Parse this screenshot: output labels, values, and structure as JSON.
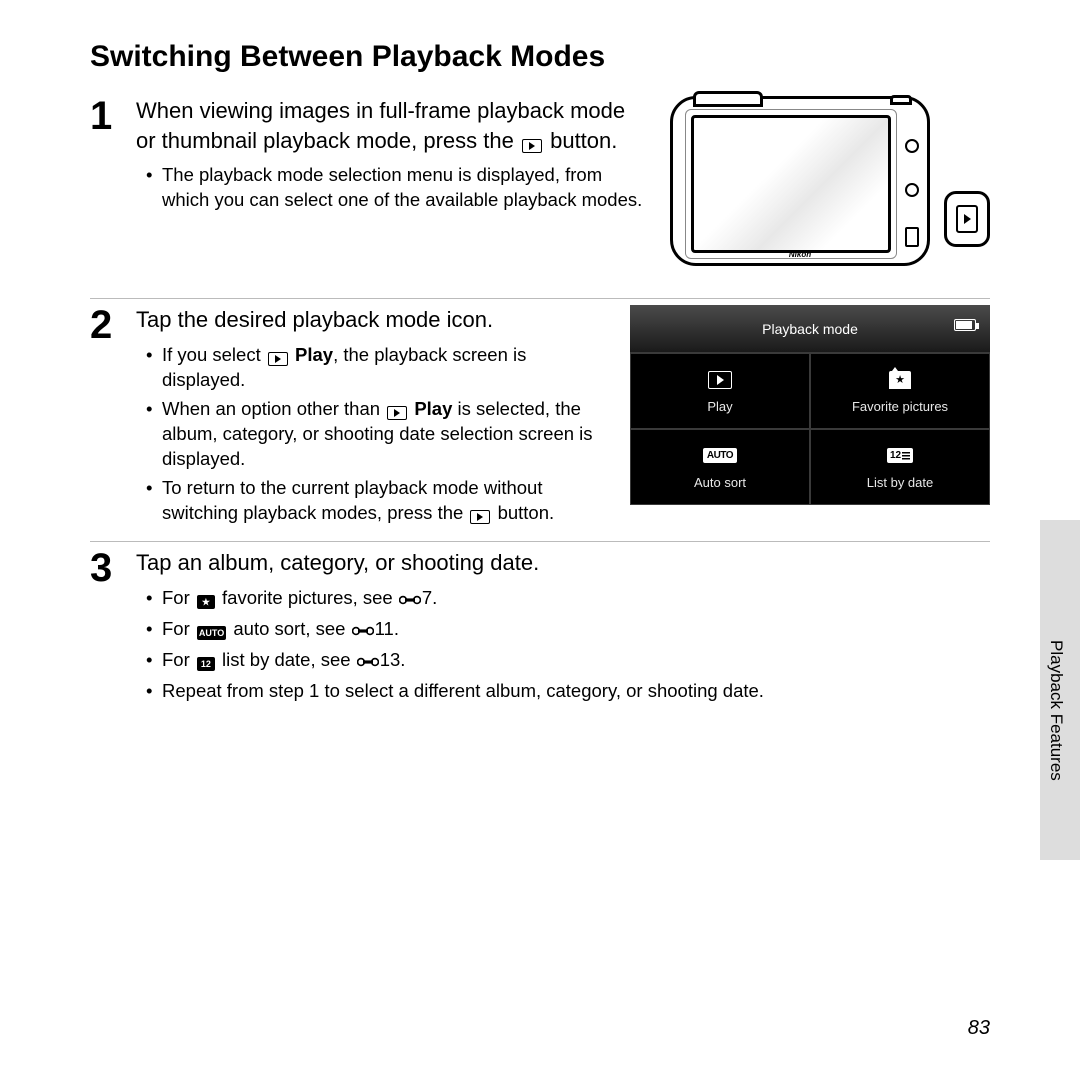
{
  "title": "Switching Between Playback Modes",
  "side_label": "Playback Features",
  "page_number": "83",
  "steps": {
    "s1": {
      "num": "1",
      "title_pre": "When viewing images in full-frame playback mode or thumbnail playback mode, press the ",
      "title_post": " button.",
      "b1": "The playback mode selection menu is displayed, from which you can select one of the available playback modes."
    },
    "s2": {
      "num": "2",
      "title": "Tap the desired playback mode icon.",
      "b1_pre": "If you select ",
      "b1_bold": " Play",
      "b1_post": ", the playback screen is displayed.",
      "b2_pre": "When an option other than ",
      "b2_bold": " Play",
      "b2_post": " is selected, the album, category, or shooting date selection screen is displayed.",
      "b3_pre": "To return to the current playback mode without switching playback modes, press the ",
      "b3_post": " button."
    },
    "s3": {
      "num": "3",
      "title": "Tap an album, category, or shooting date.",
      "b1_pre": "For ",
      "b1_mid": " favorite pictures, see ",
      "b1_post": "7.",
      "b2_pre": "For ",
      "b2_mid": " auto sort, see ",
      "b2_post": "11.",
      "b3_pre": "For ",
      "b3_mid": " list by date, see ",
      "b3_post": "13.",
      "b4": "Repeat from step 1 to select a different album, category, or shooting date."
    }
  },
  "camera": {
    "brand": "Nikon"
  },
  "pbmode": {
    "header": "Playback mode",
    "play": "Play",
    "fav": "Favorite pictures",
    "auto_icon": "AUTO",
    "auto": "Auto sort",
    "list_icon": "12",
    "list": "List by date"
  },
  "badges": {
    "star": "★",
    "auto": "AUTO",
    "list": "12"
  }
}
